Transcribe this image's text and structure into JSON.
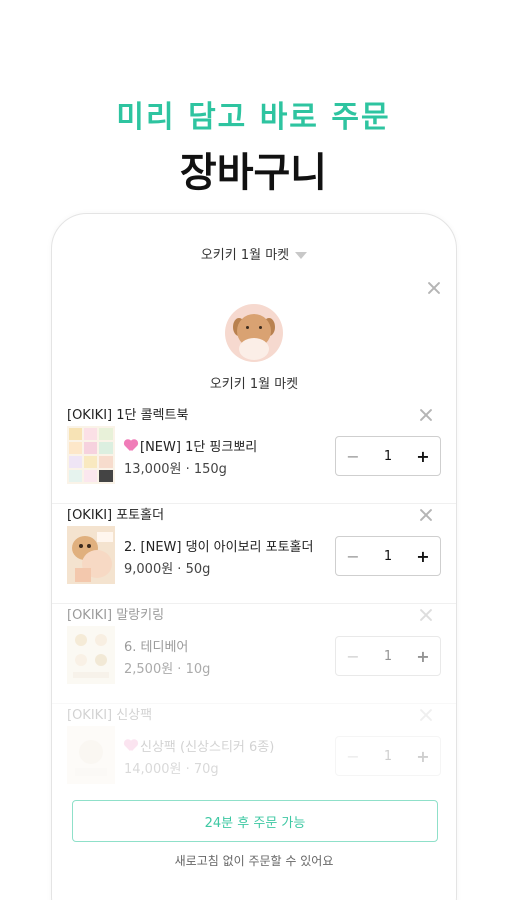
{
  "hero": {
    "subtitle": "미리 담고 바로 주문",
    "title": "장바구니"
  },
  "market_selector": {
    "label": "오키키 1월 마켓"
  },
  "seller": {
    "name": "오키키 1월 마켓"
  },
  "sections": [
    {
      "title": "[OKIKI] 1단 콜렉트북",
      "product": "[NEW] 1단 핑크뽀리",
      "price": "13,000원 · 150g",
      "qty": "1",
      "has_heart": true
    },
    {
      "title": "[OKIKI] 포토홀더",
      "product": "2. [NEW] 댕이 아이보리 포토홀더",
      "price": "9,000원 · 50g",
      "qty": "1",
      "has_heart": false
    },
    {
      "title": "[OKIKI] 말랑키링",
      "product": "6. 테디베어",
      "price": "2,500원 · 10g",
      "qty": "1",
      "has_heart": false
    },
    {
      "title": "[OKIKI] 신상팩",
      "product": "신상팩 (신상스티커 6종)",
      "price": "14,000원 · 70g",
      "qty": "1",
      "has_heart": true
    }
  ],
  "stepper": {
    "minus": "−",
    "plus": "+"
  },
  "cta": {
    "label": "24분 후 주문 가능"
  },
  "hint": "새로고침 없이 주문할 수 있어요",
  "colors": {
    "accent": "#2ec4a0",
    "cta_border": "#8fe0c9",
    "heart": "#f07cb8"
  }
}
